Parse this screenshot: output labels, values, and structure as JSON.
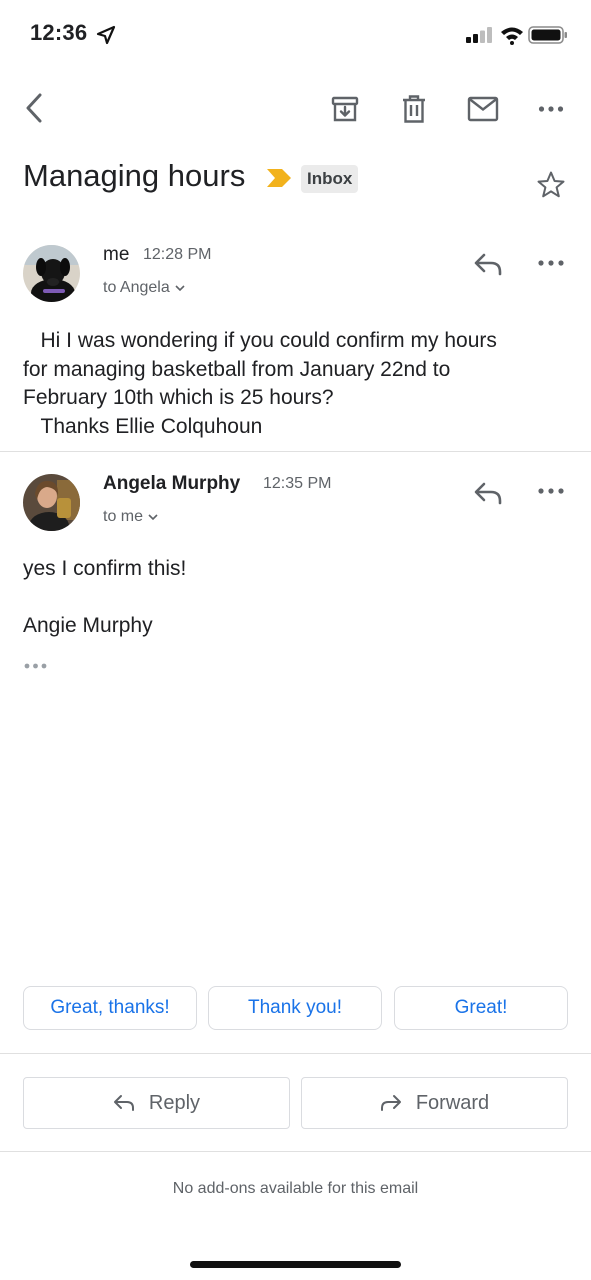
{
  "status_bar": {
    "time": "12:36",
    "icons": [
      "location-arrow-icon",
      "cellular-signal-icon",
      "wifi-icon",
      "battery-icon"
    ]
  },
  "toolbar": {
    "icons": [
      "back-chevron-icon",
      "archive-icon",
      "trash-icon",
      "mark-unread-mail-icon",
      "more-horizontal-icon"
    ]
  },
  "thread": {
    "subject": "Managing hours",
    "label": "Inbox",
    "importance_marker_color": "#f2b21c"
  },
  "messages": [
    {
      "sender": "me",
      "time": "12:28 PM",
      "recipient": "to Angela",
      "body": "   Hi I was wondering if you could confirm my hours\nfor managing basketball from January 22nd to\nFebruary 10th which is 25 hours?\n   Thanks Ellie Colquhoun"
    },
    {
      "sender": "Angela Murphy",
      "time": "12:35 PM",
      "recipient": "to me",
      "body_line1": "yes I confirm this!",
      "body_line2": "Angie Murphy"
    }
  ],
  "smart_replies": [
    "Great, thanks!",
    "Thank you!",
    "Great!"
  ],
  "actions": {
    "reply": "Reply",
    "forward": "Forward"
  },
  "footer": {
    "note": "No add-ons available for this email"
  },
  "colors": {
    "accent": "#1a73e8",
    "secondary_text": "#5f6368",
    "divider": "#e0e0e0"
  }
}
